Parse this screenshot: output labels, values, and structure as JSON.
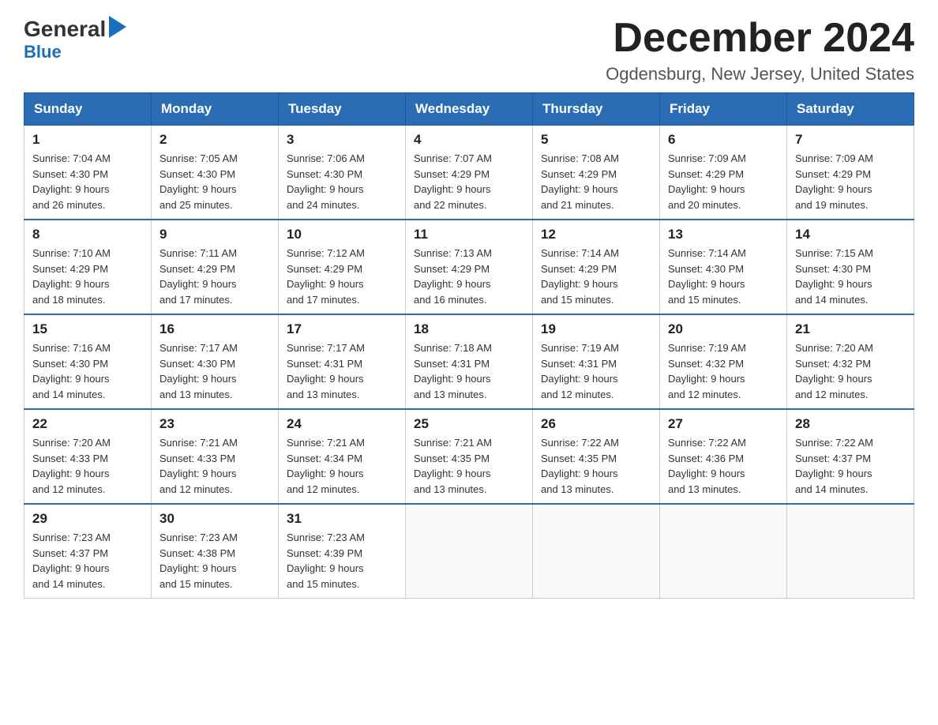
{
  "logo": {
    "general": "General",
    "blue": "Blue"
  },
  "header": {
    "month": "December 2024",
    "location": "Ogdensburg, New Jersey, United States"
  },
  "days_of_week": [
    "Sunday",
    "Monday",
    "Tuesday",
    "Wednesday",
    "Thursday",
    "Friday",
    "Saturday"
  ],
  "weeks": [
    [
      {
        "day": "1",
        "sunrise": "7:04 AM",
        "sunset": "4:30 PM",
        "daylight": "9 hours and 26 minutes."
      },
      {
        "day": "2",
        "sunrise": "7:05 AM",
        "sunset": "4:30 PM",
        "daylight": "9 hours and 25 minutes."
      },
      {
        "day": "3",
        "sunrise": "7:06 AM",
        "sunset": "4:30 PM",
        "daylight": "9 hours and 24 minutes."
      },
      {
        "day": "4",
        "sunrise": "7:07 AM",
        "sunset": "4:29 PM",
        "daylight": "9 hours and 22 minutes."
      },
      {
        "day": "5",
        "sunrise": "7:08 AM",
        "sunset": "4:29 PM",
        "daylight": "9 hours and 21 minutes."
      },
      {
        "day": "6",
        "sunrise": "7:09 AM",
        "sunset": "4:29 PM",
        "daylight": "9 hours and 20 minutes."
      },
      {
        "day": "7",
        "sunrise": "7:09 AM",
        "sunset": "4:29 PM",
        "daylight": "9 hours and 19 minutes."
      }
    ],
    [
      {
        "day": "8",
        "sunrise": "7:10 AM",
        "sunset": "4:29 PM",
        "daylight": "9 hours and 18 minutes."
      },
      {
        "day": "9",
        "sunrise": "7:11 AM",
        "sunset": "4:29 PM",
        "daylight": "9 hours and 17 minutes."
      },
      {
        "day": "10",
        "sunrise": "7:12 AM",
        "sunset": "4:29 PM",
        "daylight": "9 hours and 17 minutes."
      },
      {
        "day": "11",
        "sunrise": "7:13 AM",
        "sunset": "4:29 PM",
        "daylight": "9 hours and 16 minutes."
      },
      {
        "day": "12",
        "sunrise": "7:14 AM",
        "sunset": "4:29 PM",
        "daylight": "9 hours and 15 minutes."
      },
      {
        "day": "13",
        "sunrise": "7:14 AM",
        "sunset": "4:30 PM",
        "daylight": "9 hours and 15 minutes."
      },
      {
        "day": "14",
        "sunrise": "7:15 AM",
        "sunset": "4:30 PM",
        "daylight": "9 hours and 14 minutes."
      }
    ],
    [
      {
        "day": "15",
        "sunrise": "7:16 AM",
        "sunset": "4:30 PM",
        "daylight": "9 hours and 14 minutes."
      },
      {
        "day": "16",
        "sunrise": "7:17 AM",
        "sunset": "4:30 PM",
        "daylight": "9 hours and 13 minutes."
      },
      {
        "day": "17",
        "sunrise": "7:17 AM",
        "sunset": "4:31 PM",
        "daylight": "9 hours and 13 minutes."
      },
      {
        "day": "18",
        "sunrise": "7:18 AM",
        "sunset": "4:31 PM",
        "daylight": "9 hours and 13 minutes."
      },
      {
        "day": "19",
        "sunrise": "7:19 AM",
        "sunset": "4:31 PM",
        "daylight": "9 hours and 12 minutes."
      },
      {
        "day": "20",
        "sunrise": "7:19 AM",
        "sunset": "4:32 PM",
        "daylight": "9 hours and 12 minutes."
      },
      {
        "day": "21",
        "sunrise": "7:20 AM",
        "sunset": "4:32 PM",
        "daylight": "9 hours and 12 minutes."
      }
    ],
    [
      {
        "day": "22",
        "sunrise": "7:20 AM",
        "sunset": "4:33 PM",
        "daylight": "9 hours and 12 minutes."
      },
      {
        "day": "23",
        "sunrise": "7:21 AM",
        "sunset": "4:33 PM",
        "daylight": "9 hours and 12 minutes."
      },
      {
        "day": "24",
        "sunrise": "7:21 AM",
        "sunset": "4:34 PM",
        "daylight": "9 hours and 12 minutes."
      },
      {
        "day": "25",
        "sunrise": "7:21 AM",
        "sunset": "4:35 PM",
        "daylight": "9 hours and 13 minutes."
      },
      {
        "day": "26",
        "sunrise": "7:22 AM",
        "sunset": "4:35 PM",
        "daylight": "9 hours and 13 minutes."
      },
      {
        "day": "27",
        "sunrise": "7:22 AM",
        "sunset": "4:36 PM",
        "daylight": "9 hours and 13 minutes."
      },
      {
        "day": "28",
        "sunrise": "7:22 AM",
        "sunset": "4:37 PM",
        "daylight": "9 hours and 14 minutes."
      }
    ],
    [
      {
        "day": "29",
        "sunrise": "7:23 AM",
        "sunset": "4:37 PM",
        "daylight": "9 hours and 14 minutes."
      },
      {
        "day": "30",
        "sunrise": "7:23 AM",
        "sunset": "4:38 PM",
        "daylight": "9 hours and 15 minutes."
      },
      {
        "day": "31",
        "sunrise": "7:23 AM",
        "sunset": "4:39 PM",
        "daylight": "9 hours and 15 minutes."
      },
      null,
      null,
      null,
      null
    ]
  ]
}
